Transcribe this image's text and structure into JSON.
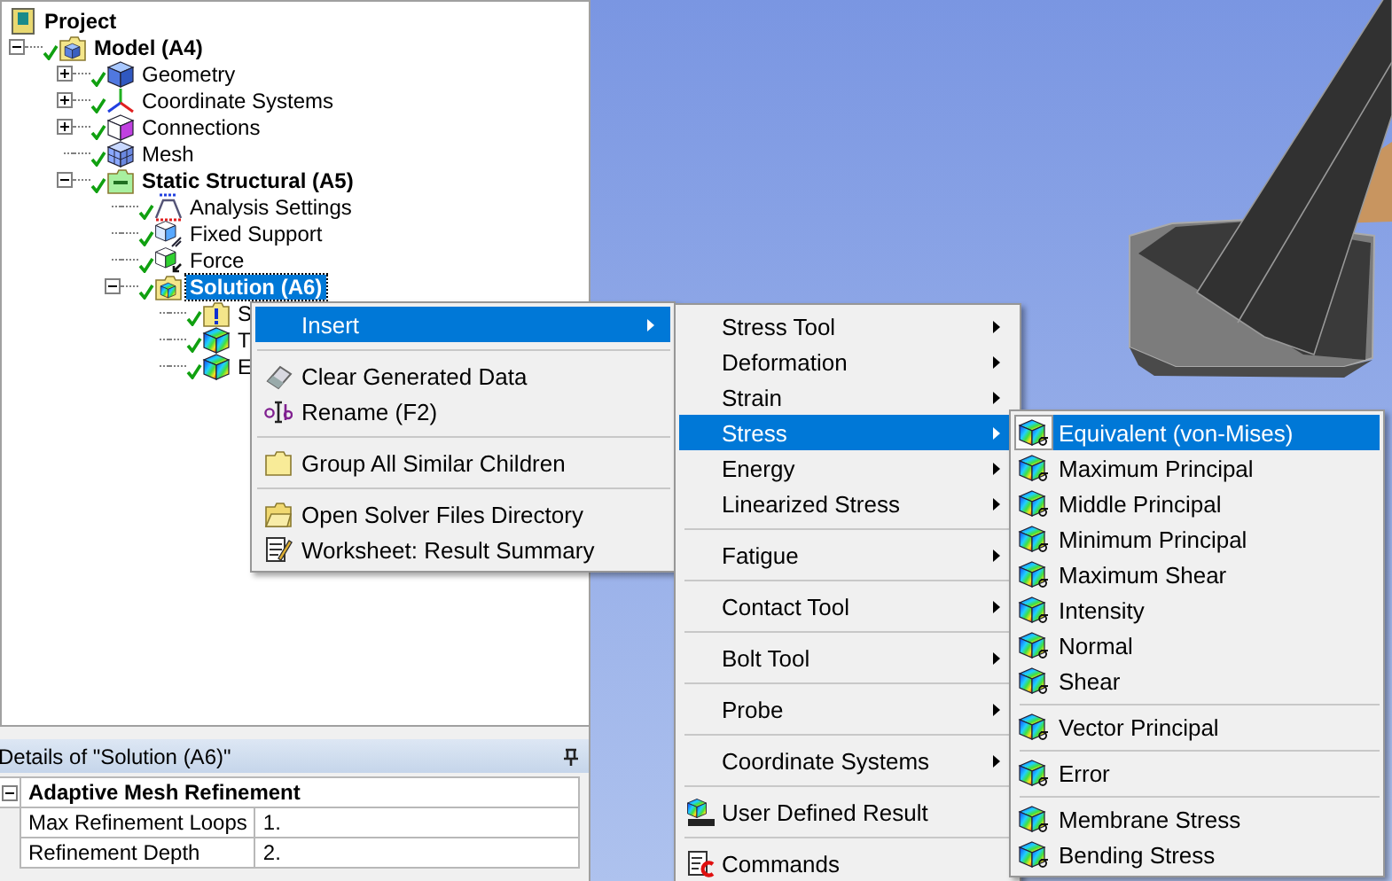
{
  "tree": [
    {
      "label": "Project",
      "kind": "project",
      "bold": true,
      "checked": false,
      "selected": false,
      "children": [
        {
          "label": "Model (A4)",
          "kind": "model",
          "bold": true,
          "checked": true,
          "expanded": true,
          "selected": false,
          "children": [
            {
              "label": "Geometry",
              "kind": "geometry",
              "bold": false,
              "checked": true,
              "expanded": false,
              "selected": false
            },
            {
              "label": "Coordinate Systems",
              "kind": "coordinates",
              "bold": false,
              "checked": true,
              "expanded": false,
              "selected": false
            },
            {
              "label": "Connections",
              "kind": "connections",
              "bold": false,
              "checked": true,
              "expanded": false,
              "selected": false
            },
            {
              "label": "Mesh",
              "kind": "mesh",
              "bold": false,
              "checked": true,
              "selected": false
            },
            {
              "label": "Static Structural (A5)",
              "kind": "environment",
              "bold": true,
              "checked": true,
              "expanded": true,
              "selected": false,
              "children": [
                {
                  "label": "Analysis Settings",
                  "kind": "settings",
                  "bold": false,
                  "checked": true,
                  "selected": false
                },
                {
                  "label": "Fixed Support",
                  "kind": "support",
                  "bold": false,
                  "checked": true,
                  "selected": false
                },
                {
                  "label": "Force",
                  "kind": "force",
                  "bold": false,
                  "checked": true,
                  "selected": false
                },
                {
                  "label": "Solution (A6)",
                  "kind": "solution",
                  "bold": true,
                  "checked": true,
                  "expanded": true,
                  "selected": true,
                  "children": [
                    {
                      "label": "S",
                      "kind": "information",
                      "bold": false,
                      "checked": true,
                      "selected": false
                    },
                    {
                      "label": "T",
                      "kind": "result",
                      "bold": false,
                      "checked": true,
                      "selected": false
                    },
                    {
                      "label": "E",
                      "kind": "result",
                      "bold": false,
                      "checked": true,
                      "selected": false
                    }
                  ]
                }
              ]
            }
          ]
        }
      ]
    }
  ],
  "details": {
    "title": "Details of \"Solution (A6)\"",
    "groups": [
      {
        "label": "Adaptive Mesh Refinement",
        "expanded": true,
        "rows": [
          {
            "name": "Max Refinement Loops",
            "value": "1."
          },
          {
            "name": "Refinement Depth",
            "value": "2."
          }
        ]
      }
    ]
  },
  "menus": [
    {
      "items": [
        {
          "kind": "command",
          "label": "Insert",
          "selected": true,
          "submenu": true
        },
        {
          "kind": "separator"
        },
        {
          "kind": "command",
          "label": "Clear Generated Data",
          "selected": false,
          "submenu": false
        },
        {
          "kind": "command",
          "label": "Rename (F2)",
          "selected": false,
          "submenu": false
        },
        {
          "kind": "separator"
        },
        {
          "kind": "command",
          "label": "Group All Similar Children",
          "selected": false,
          "submenu": false
        },
        {
          "kind": "separator"
        },
        {
          "kind": "command",
          "label": "Open Solver Files Directory",
          "selected": false,
          "submenu": false
        },
        {
          "kind": "command",
          "label": "Worksheet: Result Summary",
          "selected": false,
          "submenu": false
        }
      ]
    },
    {
      "items": [
        {
          "kind": "command",
          "label": "Stress Tool",
          "selected": false,
          "submenu": true
        },
        {
          "kind": "command",
          "label": "Deformation",
          "selected": false,
          "submenu": true
        },
        {
          "kind": "command",
          "label": "Strain",
          "selected": false,
          "submenu": true
        },
        {
          "kind": "command",
          "label": "Stress",
          "selected": true,
          "submenu": true
        },
        {
          "kind": "command",
          "label": "Energy",
          "selected": false,
          "submenu": true
        },
        {
          "kind": "command",
          "label": "Linearized Stress",
          "selected": false,
          "submenu": true
        },
        {
          "kind": "separator"
        },
        {
          "kind": "command",
          "label": "Fatigue",
          "selected": false,
          "submenu": true
        },
        {
          "kind": "separator"
        },
        {
          "kind": "command",
          "label": "Contact Tool",
          "selected": false,
          "submenu": true
        },
        {
          "kind": "separator"
        },
        {
          "kind": "command",
          "label": "Bolt Tool",
          "selected": false,
          "submenu": true
        },
        {
          "kind": "separator"
        },
        {
          "kind": "command",
          "label": "Probe",
          "selected": false,
          "submenu": true
        },
        {
          "kind": "separator"
        },
        {
          "kind": "command",
          "label": "Coordinate Systems",
          "selected": false,
          "submenu": true
        },
        {
          "kind": "separator"
        },
        {
          "kind": "command",
          "label": "User Defined Result",
          "selected": false,
          "submenu": false
        },
        {
          "kind": "separator"
        },
        {
          "kind": "command",
          "label": "Commands",
          "selected": false,
          "submenu": false
        }
      ]
    },
    {
      "items": [
        {
          "kind": "command",
          "label": "Equivalent (von-Mises)",
          "selected": true,
          "submenu": false
        },
        {
          "kind": "command",
          "label": "Maximum Principal",
          "selected": false,
          "submenu": false
        },
        {
          "kind": "command",
          "label": "Middle Principal",
          "selected": false,
          "submenu": false
        },
        {
          "kind": "command",
          "label": "Minimum Principal",
          "selected": false,
          "submenu": false
        },
        {
          "kind": "command",
          "label": "Maximum Shear",
          "selected": false,
          "submenu": false
        },
        {
          "kind": "command",
          "label": "Intensity",
          "selected": false,
          "submenu": false
        },
        {
          "kind": "command",
          "label": "Normal",
          "selected": false,
          "submenu": false
        },
        {
          "kind": "command",
          "label": "Shear",
          "selected": false,
          "submenu": false
        },
        {
          "kind": "separator"
        },
        {
          "kind": "command",
          "label": "Vector Principal",
          "selected": false,
          "submenu": false
        },
        {
          "kind": "separator"
        },
        {
          "kind": "command",
          "label": "Error",
          "selected": false,
          "submenu": false
        },
        {
          "kind": "separator"
        },
        {
          "kind": "command",
          "label": "Membrane Stress",
          "selected": false,
          "submenu": false
        },
        {
          "kind": "command",
          "label": "Bending Stress",
          "selected": false,
          "submenu": false
        }
      ]
    }
  ]
}
